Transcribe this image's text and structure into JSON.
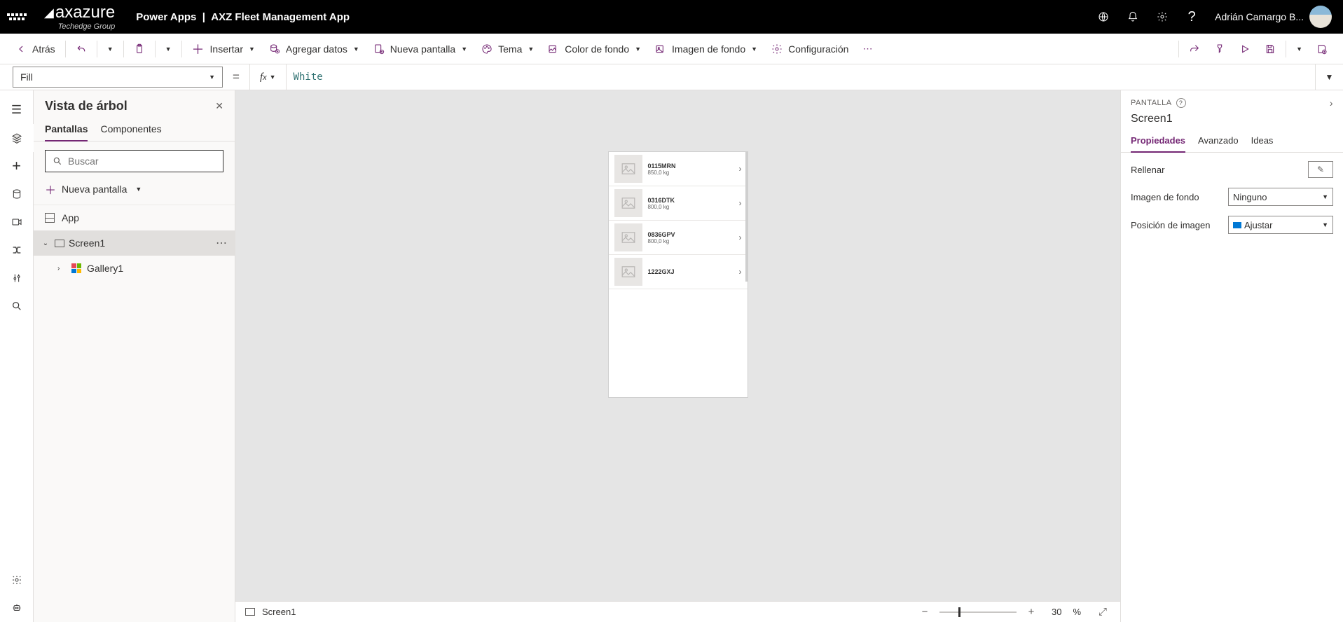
{
  "header": {
    "logo_top": "axazure",
    "logo_sub": "Techedge Group",
    "product": "Power Apps",
    "app_name": "AXZ Fleet Management App",
    "user_name": "Adrián Camargo B..."
  },
  "toolbar": {
    "back": "Atrás",
    "insert": "Insertar",
    "add_data": "Agregar datos",
    "new_screen": "Nueva pantalla",
    "theme": "Tema",
    "bg_color": "Color de fondo",
    "bg_image": "Imagen de fondo",
    "settings": "Configuración"
  },
  "fx": {
    "property": "Fill",
    "expression": "White"
  },
  "tree": {
    "title": "Vista de árbol",
    "tab_screens": "Pantallas",
    "tab_components": "Componentes",
    "search_placeholder": "Buscar",
    "new_screen": "Nueva pantalla",
    "app": "App",
    "screen": "Screen1",
    "gallery": "Gallery1"
  },
  "preview_items": [
    {
      "title": "0115MRN",
      "sub": "850,0 kg"
    },
    {
      "title": "0316DTK",
      "sub": "800,0 kg"
    },
    {
      "title": "0836GPV",
      "sub": "800,0 kg"
    },
    {
      "title": "1222GXJ",
      "sub": ""
    }
  ],
  "status": {
    "screen": "Screen1",
    "zoom": "30",
    "pct": "%"
  },
  "props": {
    "header": "PANTALLA",
    "name": "Screen1",
    "tab_props": "Propiedades",
    "tab_adv": "Avanzado",
    "tab_ideas": "Ideas",
    "fill_label": "Rellenar",
    "bgimg_label": "Imagen de fondo",
    "bgimg_value": "Ninguno",
    "imgpos_label": "Posición de imagen",
    "imgpos_value": "Ajustar"
  }
}
